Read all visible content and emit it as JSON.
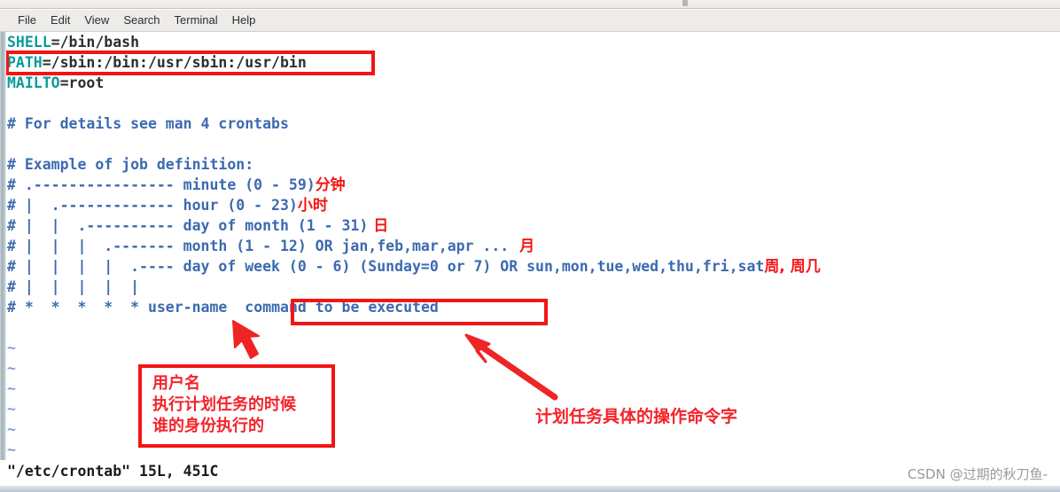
{
  "window": {
    "menubar": [
      {
        "label": "File",
        "name": "menu-file"
      },
      {
        "label": "Edit",
        "name": "menu-edit"
      },
      {
        "label": "View",
        "name": "menu-view"
      },
      {
        "label": "Search",
        "name": "menu-search"
      },
      {
        "label": "Terminal",
        "name": "menu-terminal"
      },
      {
        "label": "Help",
        "name": "menu-help"
      }
    ]
  },
  "editor": {
    "lines": {
      "l1_var": "SHELL",
      "l1_val": "=/bin/bash",
      "l2_var": "PATH",
      "l2_val": "=/sbin:/bin:/usr/sbin:/usr/bin",
      "l3_var": "MAILTO",
      "l3_val": "=root",
      "l4": "",
      "l5": "# For details see man 4 crontabs",
      "l6": "",
      "l7": "# Example of job definition:",
      "l8": "# .---------------- minute (0 - 59)",
      "l8_zh": "分钟",
      "l9": "# |  .------------- hour (0 - 23)",
      "l9_zh": "小时",
      "l10": "# |  |  .---------- day of month (1 - 31)",
      "l10_zh": "日",
      "l11": "# |  |  |  .------- month (1 - 12) OR jan,feb,mar,apr ...",
      "l11_zh": "月",
      "l12": "# |  |  |  |  .---- day of week (0 - 6) (Sunday=0 or 7) OR sun,mon,tue,wed,thu,fri,sat",
      "l12_zh": "周, 周几",
      "l13": "# |  |  |  |  |",
      "l14_pre": "# *  *  *  *  * user-name ",
      "l14_boxed": "command to be executed",
      "tilde": "~"
    },
    "status": "\"/etc/crontab\" 15L, 451C"
  },
  "annotations": {
    "username_note": "用户名\n执行计划任务的时候\n谁的身份执行的",
    "command_note": "计划任务具体的操作命令字"
  },
  "watermark": "CSDN @过期的秋刀鱼-",
  "colors": {
    "accent_red": "#f31515",
    "comment_blue": "#3c6ab0",
    "variable_teal": "#0a9a9a",
    "tilde_blue": "#7f9fd4"
  }
}
